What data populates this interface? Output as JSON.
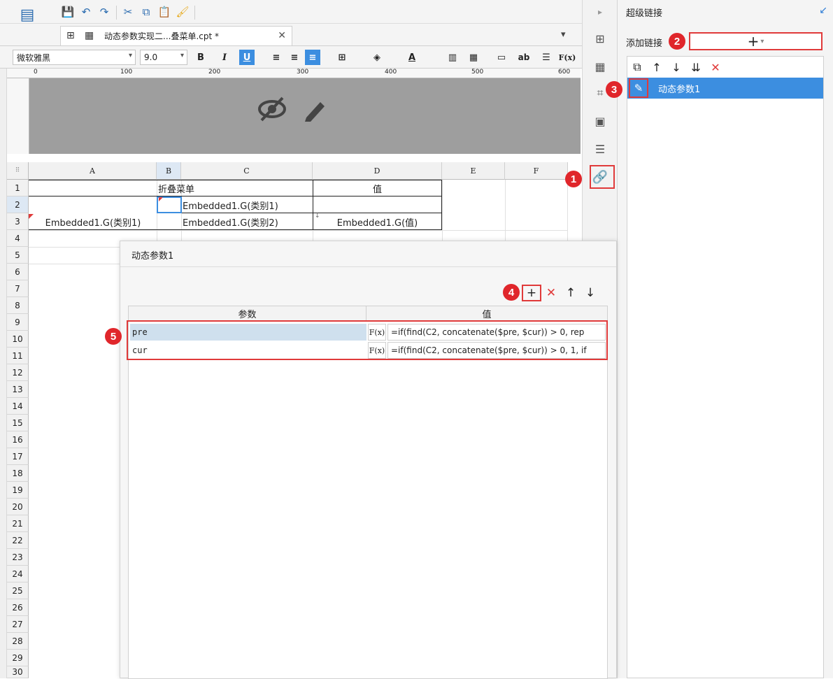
{
  "file_tab": {
    "label": "动态参数实现二...叠菜单.cpt *",
    "close": "✕"
  },
  "format": {
    "font_family": "微软雅黑",
    "font_size": "9.0"
  },
  "ruler": {
    "ticks": [
      "0",
      "100",
      "200",
      "300",
      "400",
      "500",
      "600"
    ]
  },
  "grid": {
    "columns": [
      "A",
      "B",
      "C",
      "D",
      "E",
      "F"
    ],
    "rows": [
      "1",
      "2",
      "3",
      "4",
      "5",
      "6",
      "7",
      "8",
      "9",
      "10",
      "11",
      "12",
      "13",
      "14",
      "15",
      "16",
      "17",
      "18",
      "19",
      "20",
      "21",
      "22",
      "23",
      "24",
      "25",
      "26",
      "27",
      "28",
      "29",
      "30"
    ],
    "cells": {
      "b1": "折叠菜单",
      "d1": "值",
      "c2": "Embedded1.G(类别1)",
      "a3": "Embedded1.G(类别1)",
      "c3": "Embedded1.G(类别2)",
      "d3": "Embedded1.G(值)"
    }
  },
  "right_panel": {
    "title": "超级链接",
    "add_label": "添加链接",
    "add_button": "+",
    "links": [
      {
        "name": "动态参数1"
      }
    ]
  },
  "dialog": {
    "title": "动态参数1",
    "columns": [
      "参数",
      "值"
    ],
    "params": [
      {
        "name": "pre",
        "value": "=if(find(C2, concatenate($pre, $cur)) > 0, rep"
      },
      {
        "name": "cur",
        "value": "=if(find(C2, concatenate($pre, $cur)) > 0, 1, if"
      }
    ],
    "fx_label": "F(x)"
  },
  "badges": [
    "1",
    "2",
    "3",
    "4",
    "5"
  ],
  "colors": {
    "accent": "#3c8ee0",
    "highlight_red": "#e03a3a",
    "badge_red": "#e0262b"
  }
}
